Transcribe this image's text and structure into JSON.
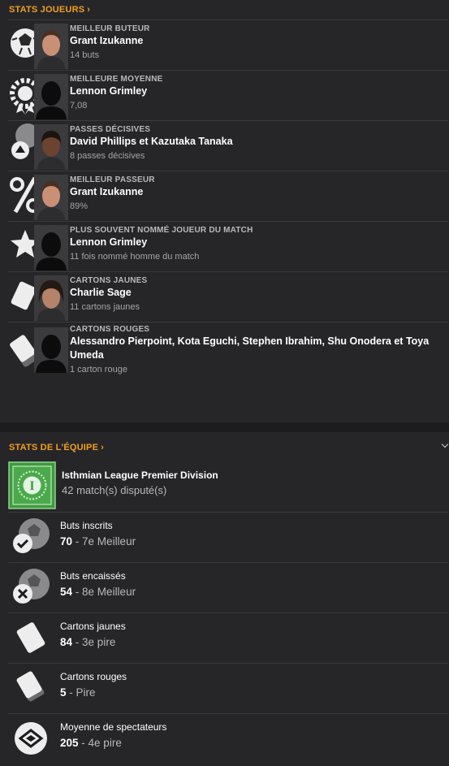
{
  "player_stats": {
    "header": "STATS JOUEURS",
    "rows": [
      {
        "label": "MEILLEUR BUTEUR",
        "name": "Grant Izukanne",
        "sub": "14 buts",
        "icon": "football-icon"
      },
      {
        "label": "MEILLEURE MOYENNE",
        "name": "Lennon Grimley",
        "sub": "7,08",
        "icon": "rating-badge-icon"
      },
      {
        "label": "PASSES DÉCISIVES",
        "name": "David Phillips et Kazutaka Tanaka",
        "sub": "8 passes décisives",
        "icon": "assist-icon"
      },
      {
        "label": "MEILLEUR PASSEUR",
        "name": "Grant Izukanne",
        "sub": "89%",
        "icon": "percent-icon"
      },
      {
        "label": "PLUS SOUVENT NOMMÉ JOUEUR DU MATCH",
        "name": "Lennon Grimley",
        "sub": "11 fois nommé homme du match",
        "icon": "star-icon"
      },
      {
        "label": "CARTONS JAUNES",
        "name": "Charlie Sage",
        "sub": "11 cartons jaunes",
        "icon": "yellow-card-icon"
      },
      {
        "label": "CARTONS ROUGES",
        "name": "Alessandro Pierpoint, Kota Eguchi, Stephen Ibrahim, Shu Onodera et Toya Umeda",
        "sub": "1 carton rouge",
        "icon": "red-card-icon"
      }
    ]
  },
  "team_stats": {
    "header": "STATS DE L'ÉQUIPE",
    "league": {
      "name": "Isthmian League Premier Division",
      "sub": "42 match(s) disputé(s)"
    },
    "rows": [
      {
        "label": "Buts inscrits",
        "value": "70",
        "rank": "- 7e Meilleur",
        "icon": "goals-scored-icon"
      },
      {
        "label": "Buts encaissés",
        "value": "54",
        "rank": "- 8e Meilleur",
        "icon": "goals-conceded-icon"
      },
      {
        "label": "Cartons jaunes",
        "value": "84",
        "rank": "- 3e pire",
        "icon": "yellow-card-icon"
      },
      {
        "label": "Cartons rouges",
        "value": "5",
        "rank": "- Pire",
        "icon": "red-card-icon"
      },
      {
        "label": "Moyenne de spectateurs",
        "value": "205",
        "rank": "- 4e pire",
        "icon": "stadium-icon"
      }
    ]
  },
  "colors": {
    "accent": "#f0a01e",
    "league_badge": "#3f9a3f"
  }
}
